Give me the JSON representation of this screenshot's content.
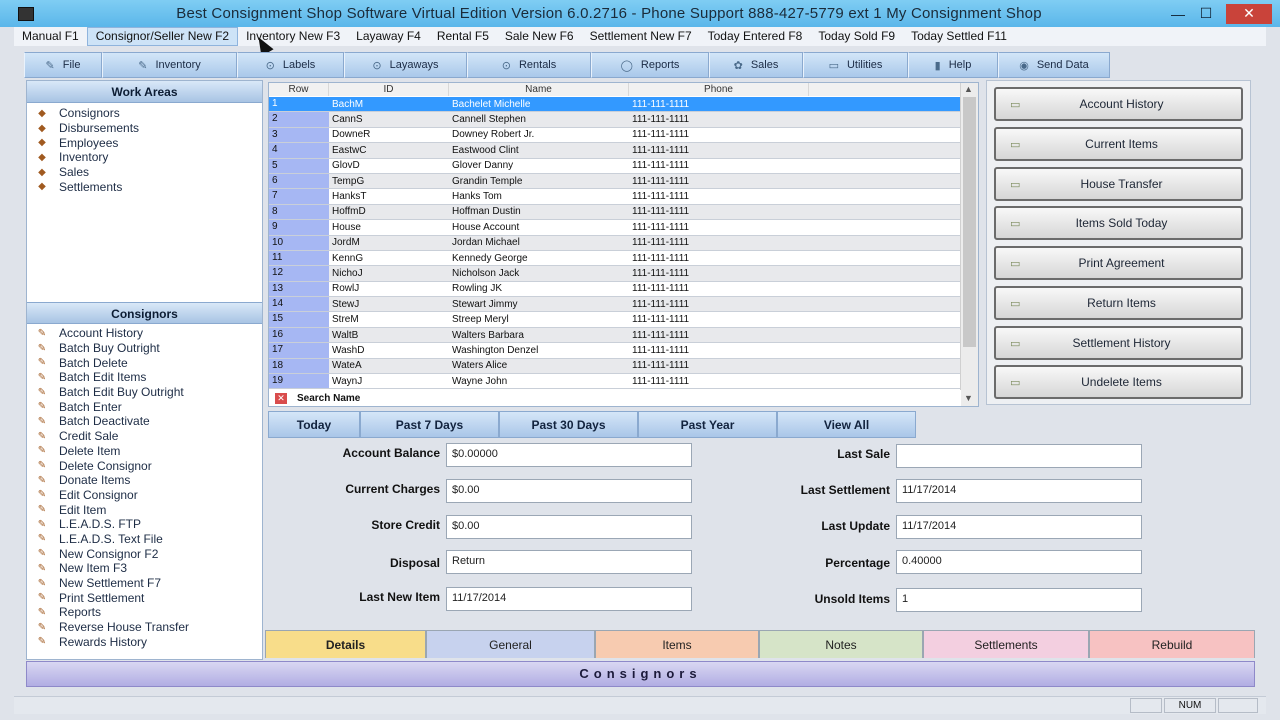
{
  "window": {
    "title": "Best Consignment Shop Software Virtual Edition Version 6.0.2716 - Phone Support 888-427-5779 ext 1 My Consignment Shop",
    "minimize": "—",
    "maximize": "☐",
    "close": "✕"
  },
  "menu": [
    "Manual  F1",
    "Consignor/Seller New F2",
    "Inventory New F3",
    "Layaway F4",
    "Rental F5",
    "Sale New F6",
    "Settlement New F7",
    "Today Entered F8",
    "Today Sold F9",
    "Today Settled F11"
  ],
  "toolbar": [
    {
      "label": "File",
      "icon": "file-icon"
    },
    {
      "label": "Inventory",
      "icon": "inventory-icon"
    },
    {
      "label": "Labels",
      "icon": "labels-icon"
    },
    {
      "label": "Layaways",
      "icon": "layaways-icon"
    },
    {
      "label": "Rentals",
      "icon": "rentals-icon"
    },
    {
      "label": "Reports",
      "icon": "reports-icon"
    },
    {
      "label": "Sales",
      "icon": "sales-icon"
    },
    {
      "label": "Utilities",
      "icon": "utilities-icon"
    },
    {
      "label": "Help",
      "icon": "help-icon"
    },
    {
      "label": "Send Data",
      "icon": "send-data-icon"
    }
  ],
  "work_areas": {
    "title": "Work Areas",
    "items": [
      "Consignors",
      "Disbursements",
      "Employees",
      "Inventory",
      "Sales",
      "Settlements"
    ]
  },
  "consignors_panel": {
    "title": "Consignors",
    "items": [
      "Account History",
      "Batch Buy Outright",
      "Batch Delete",
      "Batch Edit Items",
      "Batch Edit Buy Outright",
      "Batch Enter",
      "Batch Deactivate",
      "Credit Sale",
      "Delete Item",
      "Delete Consignor",
      "Donate Items",
      "Edit Consignor",
      "Edit Item",
      "L.E.A.D.S. FTP",
      "L.E.A.D.S. Text File",
      "New Consignor  F2",
      "New Item  F3",
      "New Settlement  F7",
      "Print Settlement",
      "Reports",
      "Reverse House Transfer",
      "Rewards History"
    ]
  },
  "grid": {
    "headers": [
      "Row",
      "ID",
      "Name",
      "Phone"
    ],
    "selected_row": 0,
    "rows": [
      [
        "1",
        "BachM",
        "Bachelet Michelle",
        "111-111-1111"
      ],
      [
        "2",
        "CannS",
        "Cannell Stephen",
        "111-111-1111"
      ],
      [
        "3",
        "DowneR",
        "Downey Robert Jr.",
        "111-111-1111"
      ],
      [
        "4",
        "EastwC",
        "Eastwood Clint",
        "111-111-1111"
      ],
      [
        "5",
        "GlovD",
        "Glover Danny",
        "111-111-1111"
      ],
      [
        "6",
        "TempG",
        "Grandin Temple",
        "111-111-1111"
      ],
      [
        "7",
        "HanksT",
        "Hanks Tom",
        "111-111-1111"
      ],
      [
        "8",
        "HoffmD",
        "Hoffman Dustin",
        "111-111-1111"
      ],
      [
        "9",
        "House",
        "House Account",
        "111-111-1111"
      ],
      [
        "10",
        "JordM",
        "Jordan Michael",
        "111-111-1111"
      ],
      [
        "11",
        "KennG",
        "Kennedy George",
        "111-111-1111"
      ],
      [
        "12",
        "NichoJ",
        "Nicholson Jack",
        "111-111-1111"
      ],
      [
        "13",
        "RowlJ",
        "Rowling JK",
        "111-111-1111"
      ],
      [
        "14",
        "StewJ",
        "Stewart Jimmy",
        "111-111-1111"
      ],
      [
        "15",
        "StreM",
        "Streep Meryl",
        "111-111-1111"
      ],
      [
        "16",
        "WaltB",
        "Walters Barbara",
        "111-111-1111"
      ],
      [
        "17",
        "WashD",
        "Washington Denzel",
        "111-111-1111"
      ],
      [
        "18",
        "WateA",
        "Waters Alice",
        "111-111-1111"
      ],
      [
        "19",
        "WaynJ",
        "Wayne John",
        "111-111-1111"
      ]
    ],
    "search_label": "Search Name"
  },
  "filters": [
    "Today",
    "Past 7 Days",
    "Past 30 Days",
    "Past Year",
    "View All"
  ],
  "actions": [
    "Account History",
    "Current Items",
    "House Transfer",
    "Items Sold Today",
    "Print Agreement",
    "Return Items",
    "Settlement History",
    "Undelete Items"
  ],
  "details": {
    "left": [
      {
        "label": "Account Balance",
        "value": "$0.00000"
      },
      {
        "label": "Current Charges",
        "value": "$0.00"
      },
      {
        "label": "Store Credit",
        "value": "$0.00"
      },
      {
        "label": "Disposal",
        "value": "Return"
      },
      {
        "label": "Last New Item",
        "value": "11/17/2014"
      }
    ],
    "right": [
      {
        "label": "Last Sale",
        "value": ""
      },
      {
        "label": "Last Settlement",
        "value": "11/17/2014"
      },
      {
        "label": "Last Update",
        "value": "11/17/2014"
      },
      {
        "label": "Percentage",
        "value": "0.40000"
      },
      {
        "label": "Unsold Items",
        "value": "1"
      }
    ]
  },
  "tabs": [
    {
      "label": "Details",
      "color": "#f8dd8a",
      "active": true
    },
    {
      "label": "General",
      "color": "#c7d2ee"
    },
    {
      "label": "Items",
      "color": "#f7cbb0"
    },
    {
      "label": "Notes",
      "color": "#d6e4c8"
    },
    {
      "label": "Settlements",
      "color": "#f3cfe0"
    },
    {
      "label": "Rebuild",
      "color": "#f7c2c2"
    }
  ],
  "bottom_title": "Consignors",
  "status": {
    "num": "NUM"
  }
}
